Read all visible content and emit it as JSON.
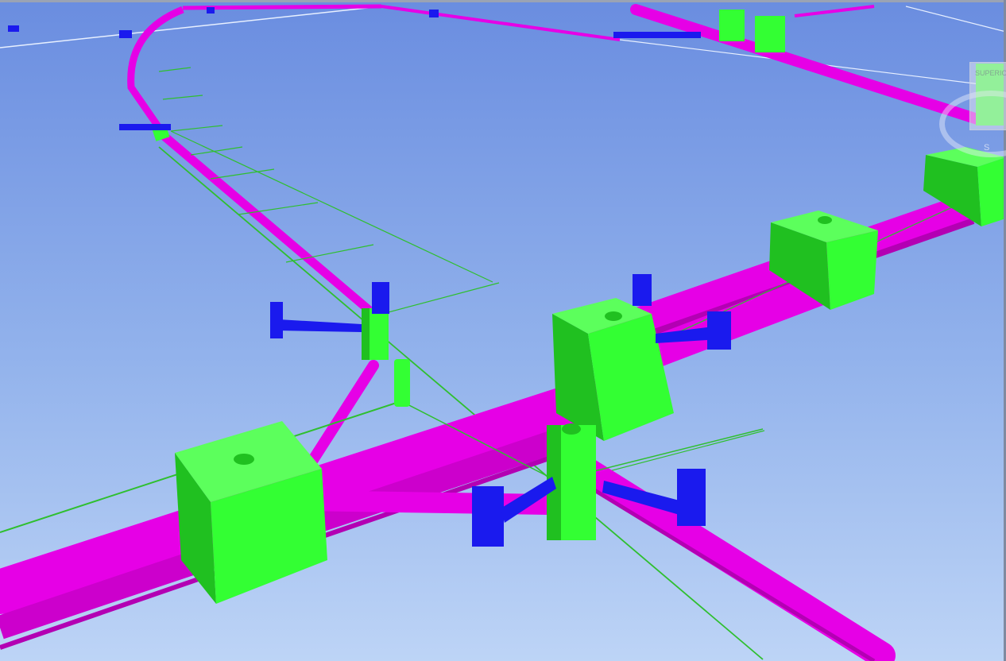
{
  "colors": {
    "sky_top": "#6b8fe0",
    "sky_bottom": "#bcd3f5",
    "pipe": "#e600e6",
    "pipe_dark": "#b300b3",
    "support_block": "#33ff33",
    "support_dark": "#1fbf1f",
    "bracket": "#1a1aee",
    "bracket_dark": "#0d0d9e",
    "wire": "#2fbf2f"
  },
  "icons": {
    "viewcube": "viewcube-icon",
    "compass": "compass-ring-icon"
  },
  "viewcube": {
    "face_label": "SUPERIOR",
    "compass_letter": "S"
  }
}
